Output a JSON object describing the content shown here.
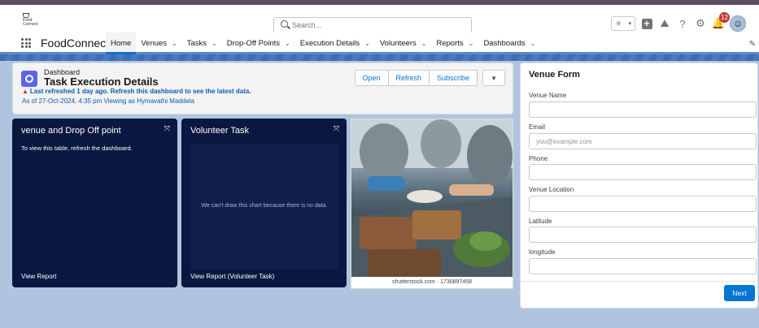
{
  "header": {
    "logo_text": "Food Connect",
    "search_placeholder": "Search...",
    "notification_count": "12"
  },
  "nav": {
    "app_name": "FoodConnect",
    "items": [
      {
        "label": "Home",
        "has_menu": false
      },
      {
        "label": "Venues",
        "has_menu": true
      },
      {
        "label": "Tasks",
        "has_menu": true
      },
      {
        "label": "Drop-Off Points",
        "has_menu": true
      },
      {
        "label": "Execution Details",
        "has_menu": true
      },
      {
        "label": "Volunteers",
        "has_menu": true
      },
      {
        "label": "Reports",
        "has_menu": true
      },
      {
        "label": "Dashboards",
        "has_menu": true
      }
    ]
  },
  "dashboard": {
    "label": "Dashboard",
    "title": "Task Execution Details",
    "warning": "Last refreshed 1 day ago. Refresh this dashboard to see the latest data.",
    "as_of": "As of 27-Oct-2024, 4:35 pm Viewing as Hymavathi Maddela",
    "buttons": {
      "open": "Open",
      "refresh": "Refresh",
      "subscribe": "Subscribe"
    }
  },
  "components": {
    "venue": {
      "title": "venue and Drop Off point",
      "message": "To view this table, refresh the dashboard.",
      "footer": "View Report"
    },
    "volunteer": {
      "title": "Volunteer Task",
      "message": "We can't draw this chart because there is no data.",
      "footer": "View Report (Volunteer Task)"
    },
    "image_caption": "shutterstock.com · 1730897458"
  },
  "form": {
    "title": "Venue Form",
    "fields": [
      {
        "label": "Venue Name",
        "placeholder": ""
      },
      {
        "label": "Email",
        "placeholder": "you@example.com"
      },
      {
        "label": "Phone",
        "placeholder": ""
      },
      {
        "label": "Venue Location",
        "placeholder": ""
      },
      {
        "label": "Latitude",
        "placeholder": ""
      },
      {
        "label": "longitude",
        "placeholder": ""
      }
    ],
    "next_label": "Next"
  }
}
